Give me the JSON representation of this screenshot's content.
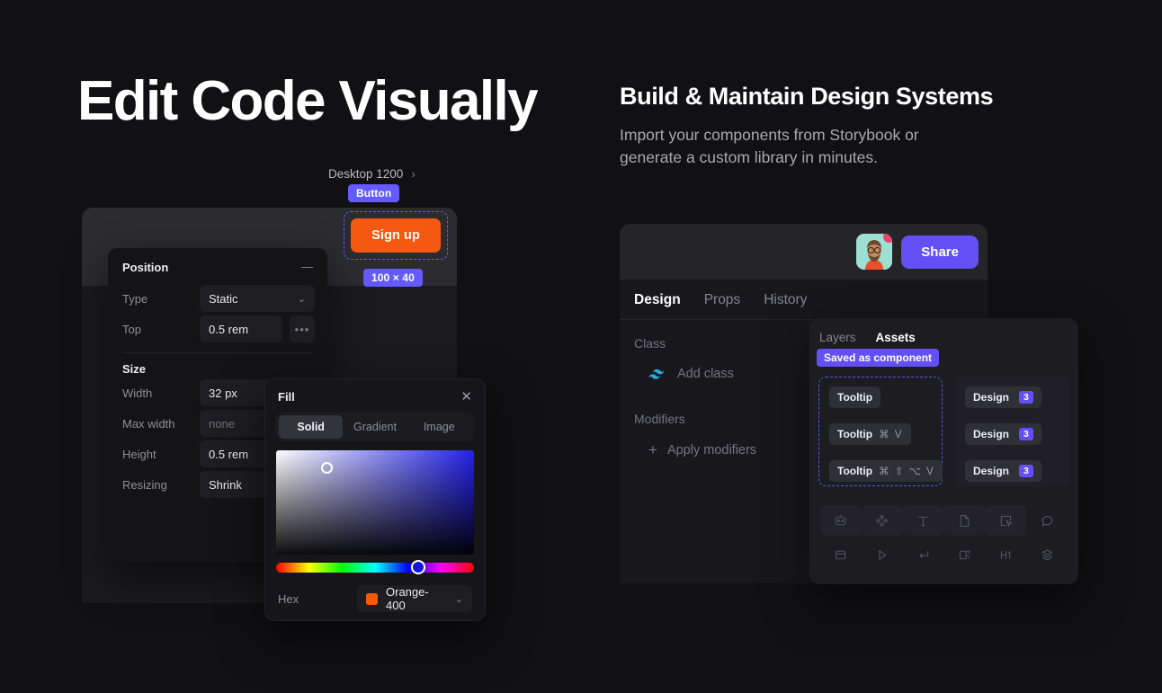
{
  "left": {
    "heading": "Edit Code Visually",
    "canvas": {
      "breadcrumb": "Desktop 1200",
      "chevron_icon": "chevron-right-icon",
      "component_badge": "Button",
      "size_badge": "100 × 40",
      "signup_label": "Sign up",
      "signup_color": "#f4590f",
      "selection_color": "#635bff"
    },
    "properties": {
      "position": {
        "title": "Position",
        "collapse_icon": "minus-icon",
        "rows": [
          {
            "label": "Type",
            "value": "Static",
            "control": "select",
            "caret": "⌄"
          },
          {
            "label": "Top",
            "value": "0.5 rem",
            "control": "input",
            "more": "•••"
          }
        ]
      },
      "size": {
        "title": "Size",
        "rows": [
          {
            "label": "Width",
            "value": "32 px",
            "muted": false
          },
          {
            "label": "Max width",
            "value": "none",
            "muted": true
          },
          {
            "label": "Height",
            "value": "0.5 rem",
            "muted": false
          },
          {
            "label": "Resizing",
            "value": "Shrink",
            "muted": false
          }
        ]
      }
    },
    "fill": {
      "title": "Fill",
      "close_icon": "close-icon",
      "tabs": [
        {
          "label": "Solid",
          "active": true
        },
        {
          "label": "Gradient",
          "active": false
        },
        {
          "label": "Image",
          "active": false
        }
      ],
      "hex_label": "Hex",
      "hex_value": "Orange-400",
      "hex_swatch": "#f4590f",
      "hex_caret": "⌄"
    }
  },
  "right": {
    "heading": "Build & Maintain Design Systems",
    "subheading": "Import your components from Storybook or generate a custom library in minutes.",
    "app": {
      "avatar_name": "avatar",
      "notification_dot": true,
      "share_label": "Share",
      "share_color": "#6250f5",
      "tabs": [
        {
          "label": "Design",
          "active": true
        },
        {
          "label": "Props",
          "active": false
        },
        {
          "label": "History",
          "active": false
        }
      ],
      "class_section": {
        "title": "Class",
        "icon": "tailwind-icon",
        "action": "Add class"
      },
      "modifiers_section": {
        "title": "Modifiers",
        "icon": "plus-icon",
        "action": "Apply modifiers"
      }
    },
    "assets": {
      "tabs": [
        {
          "label": "Layers",
          "active": false
        },
        {
          "label": "Assets",
          "active": true
        }
      ],
      "saved_badge": "Saved as component",
      "tooltips": [
        {
          "label": "Tooltip",
          "shortcut": ""
        },
        {
          "label": "Tooltip",
          "shortcut": "⌘ V"
        },
        {
          "label": "Tooltip",
          "shortcut": "⌘ ⇧ ⌥ V"
        }
      ],
      "design_items": [
        {
          "label": "Design",
          "count": "3"
        },
        {
          "label": "Design",
          "count": "3"
        },
        {
          "label": "Design",
          "count": "3"
        }
      ],
      "toolbar_icons": [
        [
          "robot-icon",
          "components-icon",
          "text-icon",
          "page-icon",
          "select-box-icon",
          "comment-icon"
        ],
        [
          "container-icon",
          "play-icon",
          "enter-icon",
          "button-icon",
          "heading-icon",
          "layers-icon"
        ]
      ]
    }
  }
}
